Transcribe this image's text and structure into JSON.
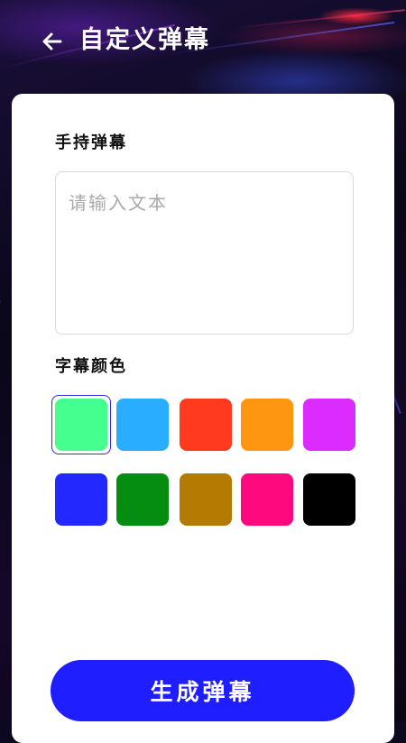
{
  "header": {
    "title": "自定义弹幕",
    "back_icon": "arrow-left-icon"
  },
  "form": {
    "text_label": "手持弹幕",
    "text_placeholder": "请输入文本",
    "text_value": "",
    "color_label": "字幕颜色"
  },
  "colors": {
    "selected_index": 0,
    "options": [
      {
        "name": "mint-green",
        "hex": "#45FF8F"
      },
      {
        "name": "sky-blue",
        "hex": "#29AEFF"
      },
      {
        "name": "red",
        "hex": "#FF3A1F"
      },
      {
        "name": "orange",
        "hex": "#FF9612"
      },
      {
        "name": "violet",
        "hex": "#DB2BFF"
      },
      {
        "name": "blue",
        "hex": "#2328FF"
      },
      {
        "name": "green",
        "hex": "#058D12"
      },
      {
        "name": "brown-gold",
        "hex": "#B47A02"
      },
      {
        "name": "pink",
        "hex": "#FF0A7E"
      },
      {
        "name": "black",
        "hex": "#000000"
      }
    ]
  },
  "action": {
    "generate_label": "生成弹幕",
    "button_color": "#1E1EFF"
  }
}
